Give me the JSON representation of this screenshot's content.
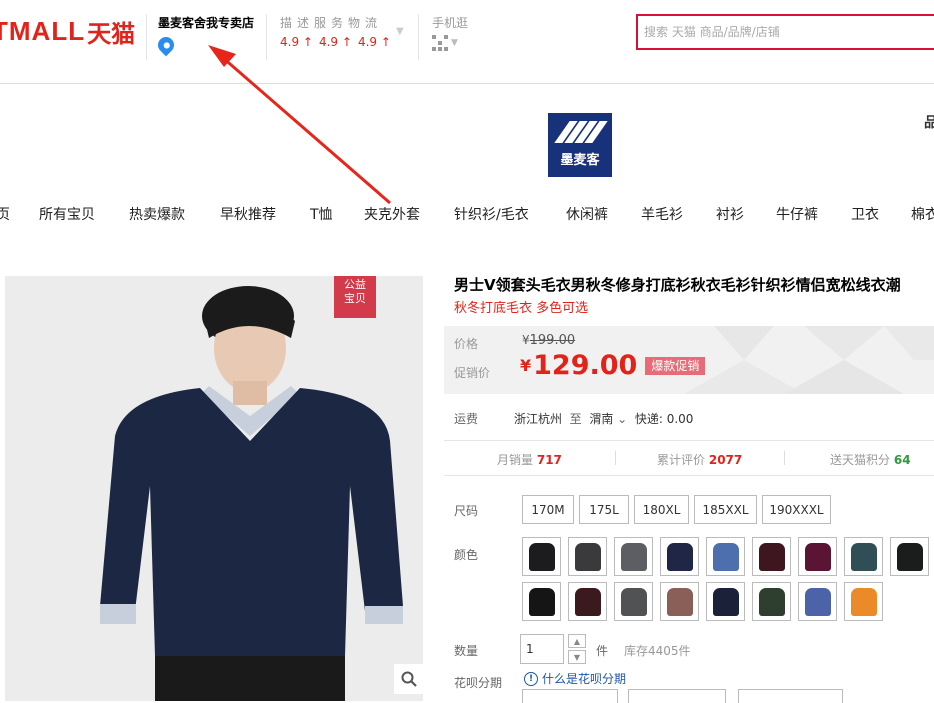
{
  "header": {
    "logo_en": "TMALL",
    "logo_cn": "天猫",
    "shop_name": "墨麦客舍我专卖店",
    "rating_label": "描述服务物流",
    "ratings": [
      {
        "value": "4.9",
        "arrow": "↑"
      },
      {
        "value": "4.9",
        "arrow": "↑"
      },
      {
        "value": "4.9",
        "arrow": "↑"
      }
    ],
    "mobile_label": "手机逛",
    "search_placeholder": "搜索 天猫 商品/品牌/店铺"
  },
  "shop": {
    "logo_text": "墨麦客",
    "edge_char": "品"
  },
  "nav": [
    "页",
    "所有宝贝",
    "热卖爆款",
    "早秋推荐",
    "T恤",
    "夹克外套",
    "针织衫/毛衣",
    "休闲裤",
    "羊毛衫",
    "衬衫",
    "牛仔裤",
    "卫衣",
    "棉衣"
  ],
  "product": {
    "charity_badge_line1": "公益",
    "charity_badge_line2": "宝贝",
    "title": "男士V领套头毛衣男秋冬修身打底衫秋衣毛衫针织衫情侣宽松线衣潮",
    "subtitle": "秋冬打底毛衣 多色可选",
    "price_label": "价格",
    "price_currency": "¥",
    "price_original": "199.00",
    "promo_label": "促销价",
    "promo_currency": "¥",
    "promo_price": "129.00",
    "promo_tag": "爆款促销",
    "shipping_label": "运费",
    "ship_from": "浙江杭州",
    "ship_to_prefix": "至",
    "ship_to": "渭南",
    "ship_fee": "快递: 0.00",
    "stats": {
      "monthly_label": "月销量",
      "monthly_value": "717",
      "reviews_label": "累计评价",
      "reviews_value": "2077",
      "points_label": "送天猫积分",
      "points_value": "64"
    },
    "size_label": "尺码",
    "sizes": [
      "170M",
      "175L",
      "180XL",
      "185XXL",
      "190XXXL"
    ],
    "color_label": "颜色",
    "colors": [
      "#1c1c1e",
      "#3a3a3c",
      "#5c5e63",
      "#1f2646",
      "#4e6fae",
      "#3e1620",
      "#5a1434",
      "#2f4e56",
      "#1b1d1c",
      "#151515",
      "#3b1a1e",
      "#505254",
      "#8a5f58",
      "#1a2138",
      "#2f3f2f",
      "#4d63a8",
      "#ea8a28"
    ],
    "qty_label": "数量",
    "qty_value": "1",
    "qty_unit": "件",
    "stock": "库存4405件",
    "huabei_label": "花呗分期",
    "huabei_link": "什么是花呗分期"
  }
}
